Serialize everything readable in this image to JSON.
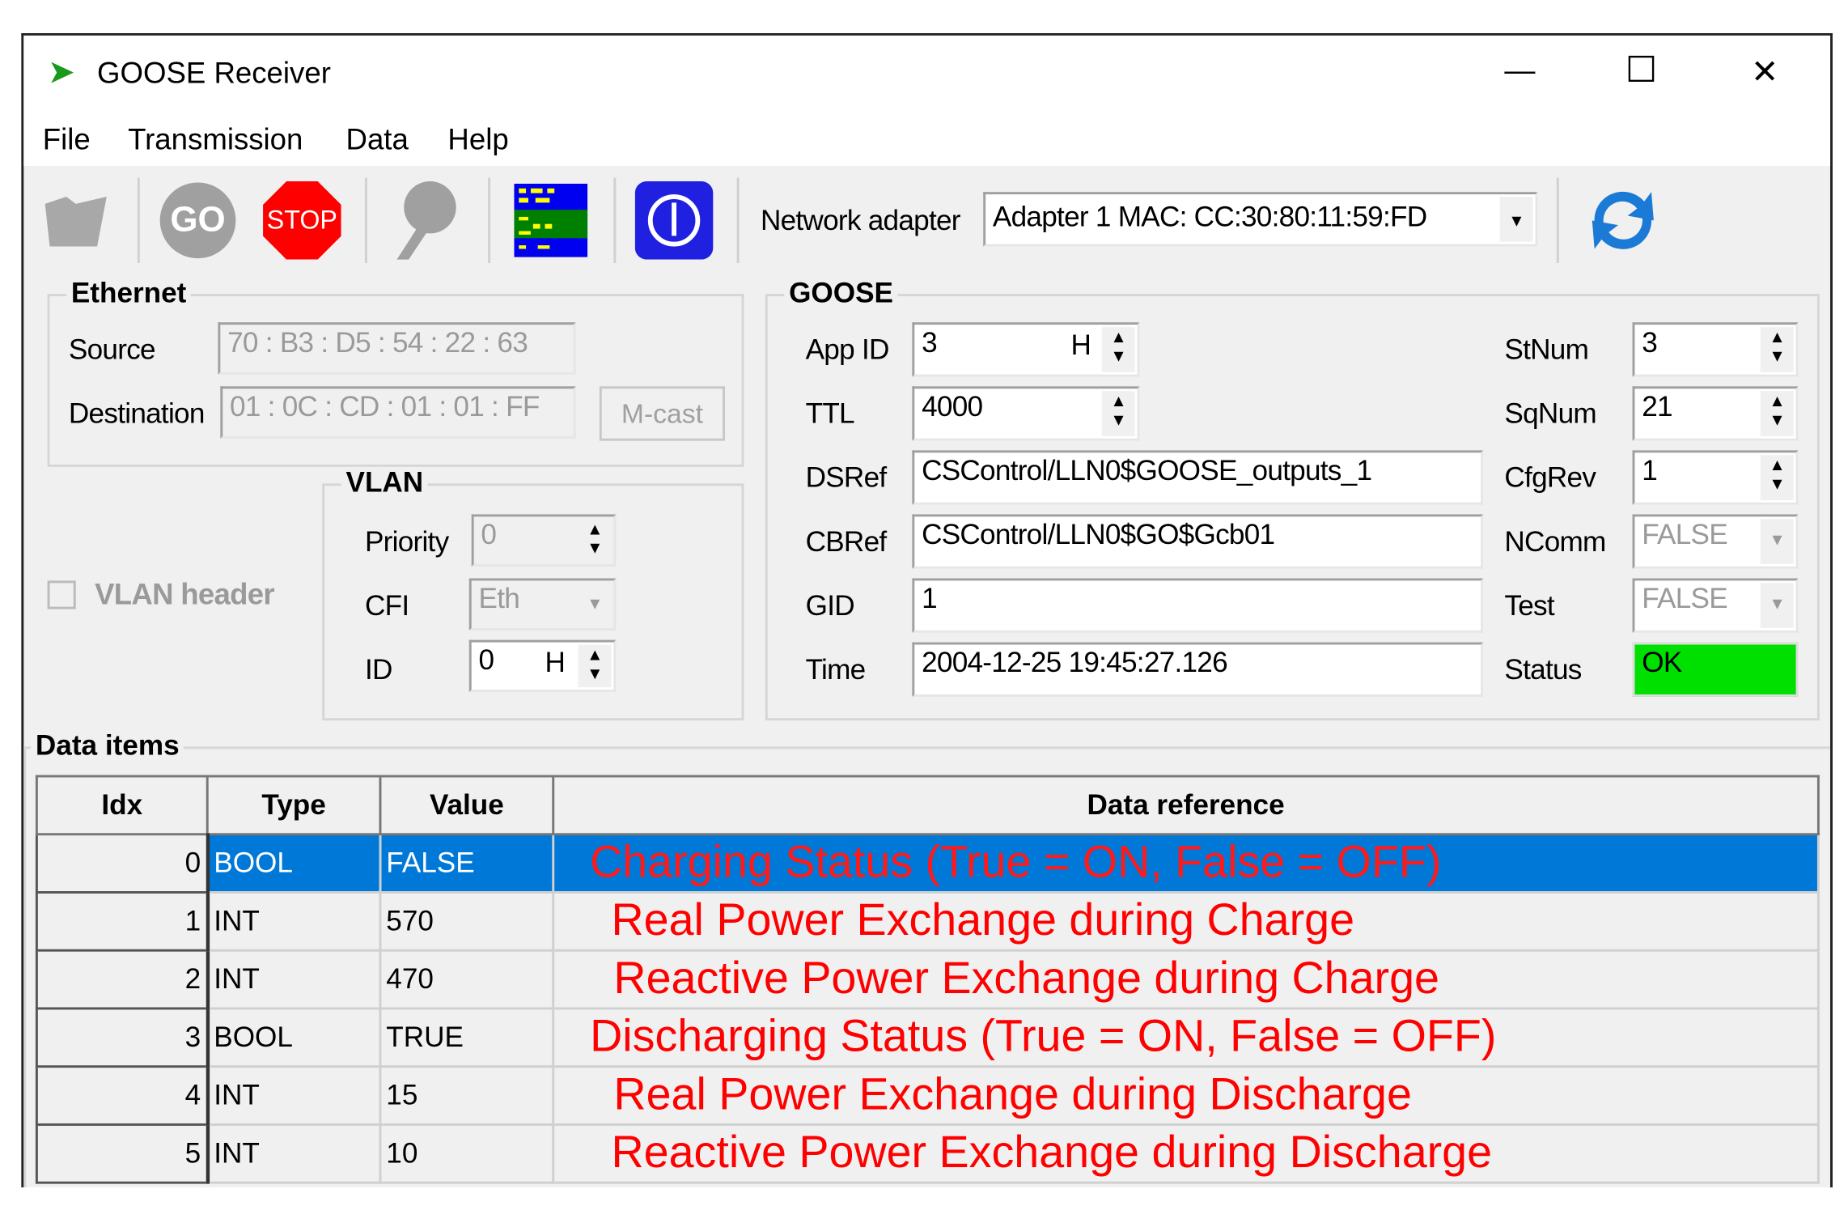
{
  "window": {
    "title": "GOOSE Receiver",
    "minimize": "—",
    "maximize": "☐",
    "close": "✕"
  },
  "menu": [
    "File",
    "Transmission",
    "Data",
    "Help"
  ],
  "toolbar": {
    "go": "GO",
    "stop": "STOP",
    "network_adapter_label": "Network adapter",
    "network_adapter_value": "Adapter 1 MAC: CC:30:80:11:59:FD"
  },
  "ethernet": {
    "title": "Ethernet",
    "source_label": "Source",
    "source": "70 : B3 : D5 : 54 : 22 : 63",
    "destination_label": "Destination",
    "destination": "01 : 0C : CD : 01 : 01 : FF",
    "mcast": "M-cast"
  },
  "vlan": {
    "title": "VLAN",
    "header_label": "VLAN header",
    "priority_label": "Priority",
    "priority": "0",
    "cfi_label": "CFI",
    "cfi": "Eth",
    "id_label": "ID",
    "id": "0",
    "id_suffix": "H"
  },
  "goose": {
    "title": "GOOSE",
    "appid_label": "App ID",
    "appid": "3",
    "appid_suffix": "H",
    "ttl_label": "TTL",
    "ttl": "4000",
    "dsref_label": "DSRef",
    "dsref": "CSControl/LLN0$GOOSE_outputs_1",
    "cbref_label": "CBRef",
    "cbref": "CSControl/LLN0$GO$Gcb01",
    "gid_label": "GID",
    "gid": "1",
    "time_label": "Time",
    "time": "2004-12-25 19:45:27.126",
    "stnum_label": "StNum",
    "stnum": "3",
    "sqnum_label": "SqNum",
    "sqnum": "21",
    "cfgrev_label": "CfgRev",
    "cfgrev": "1",
    "ncomm_label": "NComm",
    "ncomm": "FALSE",
    "test_label": "Test",
    "test": "FALSE",
    "status_label": "Status",
    "status": "OK",
    "status_color": "#00e000"
  },
  "data_items": {
    "title": "Data items",
    "columns": [
      "Idx",
      "Type",
      "Value",
      "Data reference"
    ],
    "rows": [
      {
        "idx": "0",
        "type": "BOOL",
        "value": "FALSE",
        "ref": "Charging Status (True = ON, False = OFF)"
      },
      {
        "idx": "1",
        "type": "INT",
        "value": "570",
        "ref": "Real Power Exchange during Charge"
      },
      {
        "idx": "2",
        "type": "INT",
        "value": "470",
        "ref": "Reactive Power Exchange during Charge"
      },
      {
        "idx": "3",
        "type": "BOOL",
        "value": "TRUE",
        "ref": "Discharging Status (True = ON, False = OFF)"
      },
      {
        "idx": "4",
        "type": "INT",
        "value": "15",
        "ref": "Real Power Exchange during Discharge"
      },
      {
        "idx": "5",
        "type": "INT",
        "value": "10",
        "ref": "Reactive Power Exchange during Discharge"
      }
    ]
  }
}
